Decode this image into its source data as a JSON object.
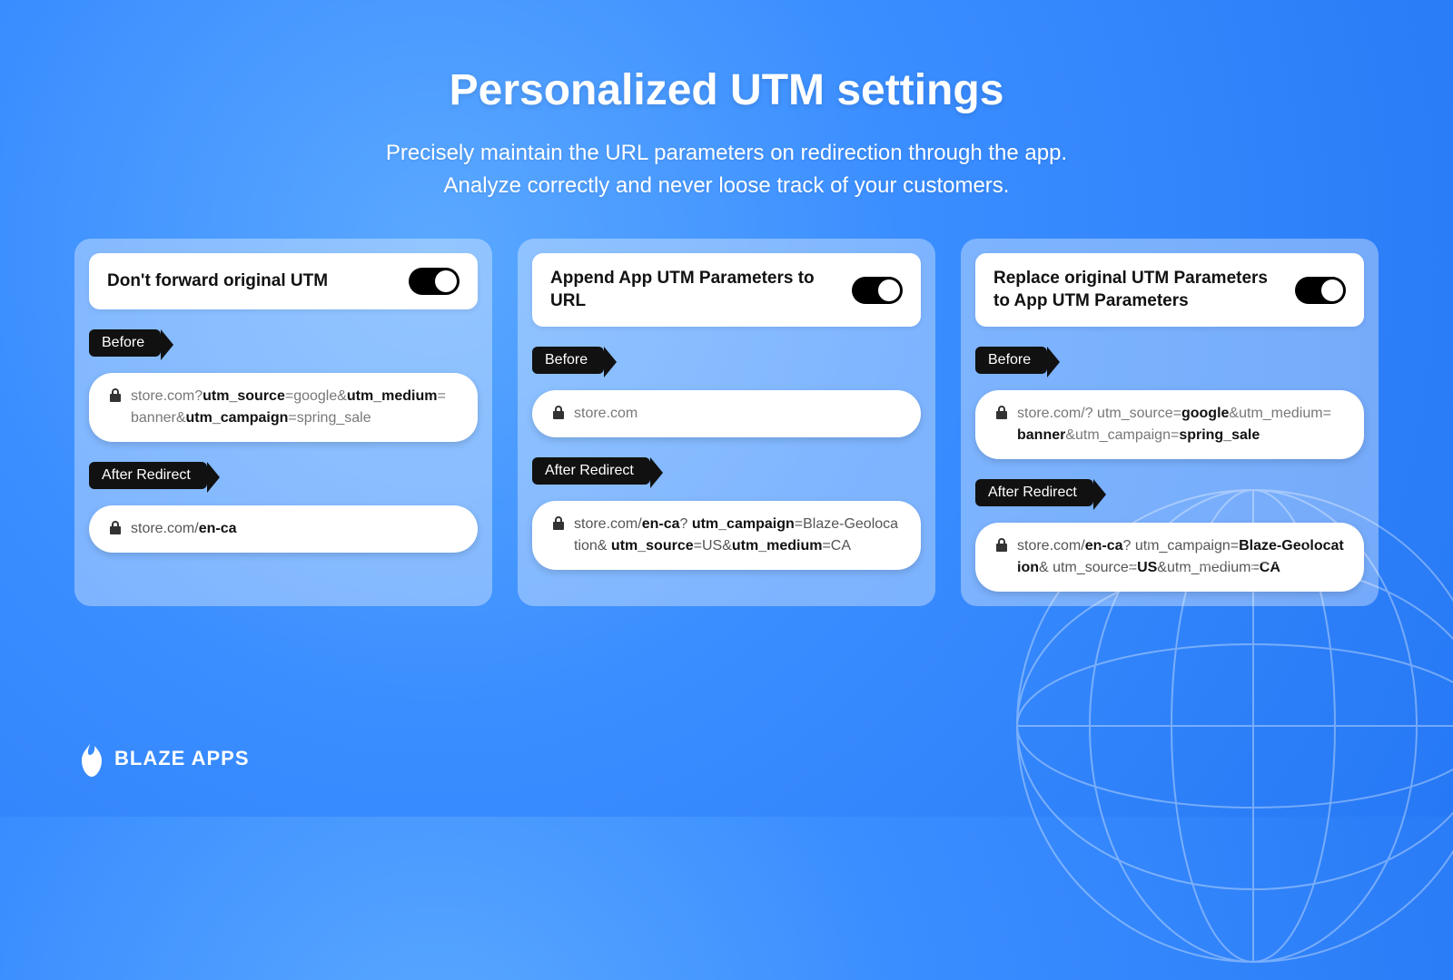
{
  "header": {
    "title": "Personalized UTM settings",
    "subtitle_line1": "Precisely maintain the URL parameters on redirection through the app.",
    "subtitle_line2": "Analyze correctly and never loose track of your customers."
  },
  "labels": {
    "before": "Before",
    "after": "After Redirect"
  },
  "cards": [
    {
      "title": "Don't forward original UTM",
      "toggle": true,
      "before": {
        "parts": [
          {
            "text": "store.com?",
            "style": "gray"
          },
          {
            "text": "utm_source",
            "style": "bold"
          },
          {
            "text": "=google&",
            "style": "gray"
          },
          {
            "text": "utm_medium",
            "style": "bold"
          },
          {
            "text": "= banner&",
            "style": "gray"
          },
          {
            "text": "utm_campaign",
            "style": "bold"
          },
          {
            "text": "=spring_sale",
            "style": "gray"
          }
        ]
      },
      "after": {
        "parts": [
          {
            "text": "store.com/",
            "style": "dim"
          },
          {
            "text": "en-ca",
            "style": "bold"
          }
        ]
      }
    },
    {
      "title": "Append App UTM Parameters to URL",
      "toggle": true,
      "before": {
        "parts": [
          {
            "text": "store.com",
            "style": "gray"
          }
        ]
      },
      "after": {
        "parts": [
          {
            "text": "store.com/",
            "style": "dim"
          },
          {
            "text": "en-ca",
            "style": "bold"
          },
          {
            "text": "? ",
            "style": "dim"
          },
          {
            "text": "utm_campaign",
            "style": "bold"
          },
          {
            "text": "=Blaze-Geolocation& ",
            "style": "dim"
          },
          {
            "text": "utm_source",
            "style": "bold"
          },
          {
            "text": "=US&",
            "style": "dim"
          },
          {
            "text": "utm_medium",
            "style": "bold"
          },
          {
            "text": "=CA",
            "style": "dim"
          }
        ]
      }
    },
    {
      "title": "Replace original UTM Parameters to App UTM Parameters",
      "toggle": true,
      "before": {
        "parts": [
          {
            "text": "store.com/?",
            "style": "gray"
          },
          {
            "text": " utm_source=",
            "style": "gray"
          },
          {
            "text": "google",
            "style": "bold"
          },
          {
            "text": "&utm_medium= ",
            "style": "gray"
          },
          {
            "text": "banner",
            "style": "bold"
          },
          {
            "text": "&utm_campaign=",
            "style": "gray"
          },
          {
            "text": "spring_sale",
            "style": "bold"
          }
        ]
      },
      "after": {
        "parts": [
          {
            "text": "store.com/",
            "style": "dim"
          },
          {
            "text": "en-ca",
            "style": "bold"
          },
          {
            "text": "?",
            "style": "dim"
          },
          {
            "text": " utm_campaign=",
            "style": "dim"
          },
          {
            "text": "Blaze-Geolocation",
            "style": "bold"
          },
          {
            "text": "& utm_source=",
            "style": "dim"
          },
          {
            "text": "US",
            "style": "bold"
          },
          {
            "text": "&utm_medium=",
            "style": "dim"
          },
          {
            "text": "CA",
            "style": "bold"
          }
        ]
      }
    }
  ],
  "logo": {
    "text": "BLAZE APPS"
  }
}
